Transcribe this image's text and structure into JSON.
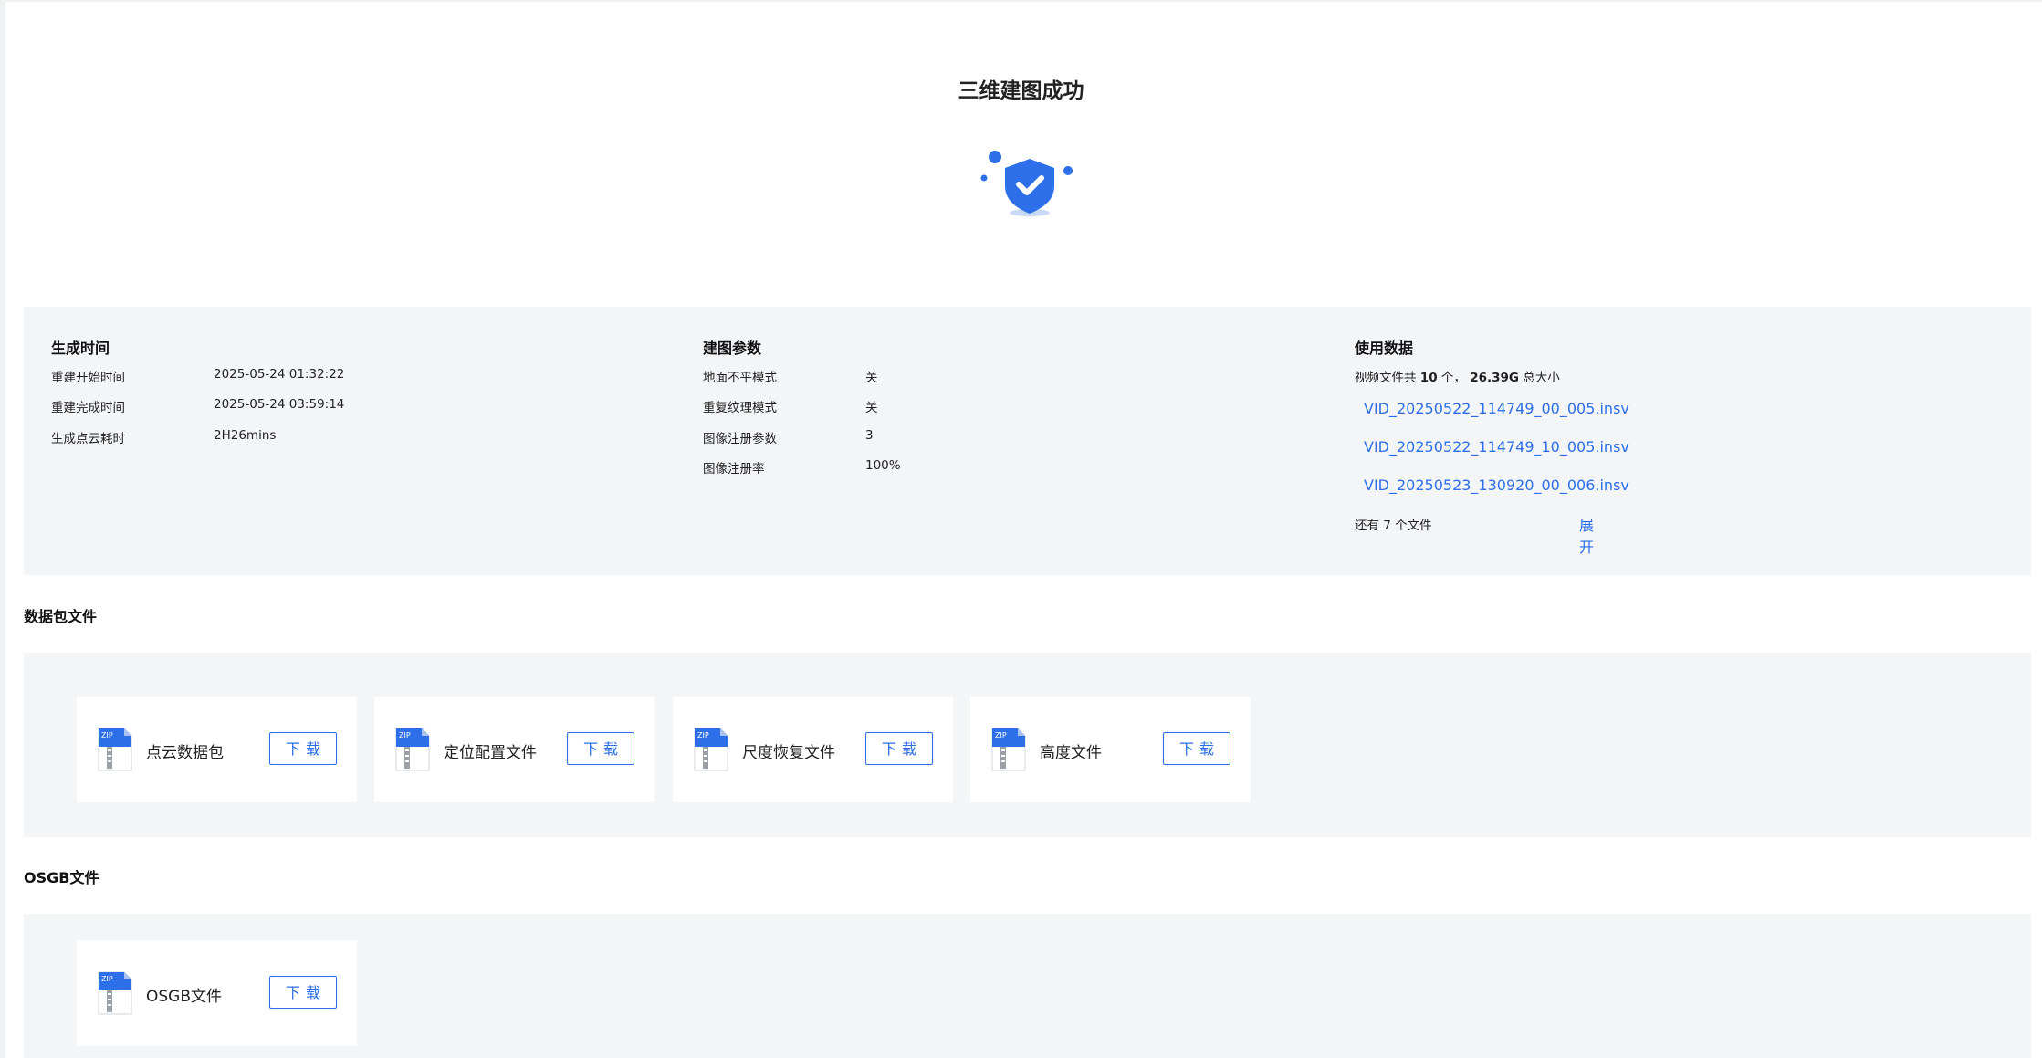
{
  "header": {
    "title": "三维建图成功"
  },
  "icons": {
    "success": "shield-check-icon",
    "file": "zip-file-icon"
  },
  "colors": {
    "accent": "#2d6fe8",
    "panel": "#f4f5f7"
  },
  "generation": {
    "heading": "生成时间",
    "rows": [
      {
        "key": "重建开始时间",
        "value": "2025-05-24 01:32:22"
      },
      {
        "key": "重建完成时间",
        "value": "2025-05-24 03:59:14"
      },
      {
        "key": "生成点云耗时",
        "value": "2H26mins"
      }
    ]
  },
  "params": {
    "heading": "建图参数",
    "rows": [
      {
        "key": "地面不平模式",
        "value": "关"
      },
      {
        "key": "重复纹理模式",
        "value": "关"
      },
      {
        "key": "图像注册参数",
        "value": "3"
      },
      {
        "key": "图像注册率",
        "value": "100%"
      }
    ]
  },
  "usage": {
    "heading": "使用数据",
    "summary_prefix": "视频文件共",
    "count": "10",
    "count_suffix": "个，",
    "size": "26.39G",
    "size_suffix": "总大小",
    "files": [
      "VID_20250522_114749_00_005.insv",
      "VID_20250522_114749_10_005.insv",
      "VID_20250523_130920_00_006.insv"
    ],
    "more_text": "还有 7 个文件",
    "expand_label": "展开"
  },
  "packages": {
    "title": "数据包文件",
    "items": [
      {
        "label": "点云数据包",
        "button": "下载"
      },
      {
        "label": "定位配置文件",
        "button": "下载"
      },
      {
        "label": "尺度恢复文件",
        "button": "下载"
      },
      {
        "label": "高度文件",
        "button": "下载"
      }
    ]
  },
  "osgb": {
    "title": "OSGB文件",
    "items": [
      {
        "label": "OSGB文件",
        "button": "下载"
      }
    ]
  },
  "zip_badge": "ZIP"
}
